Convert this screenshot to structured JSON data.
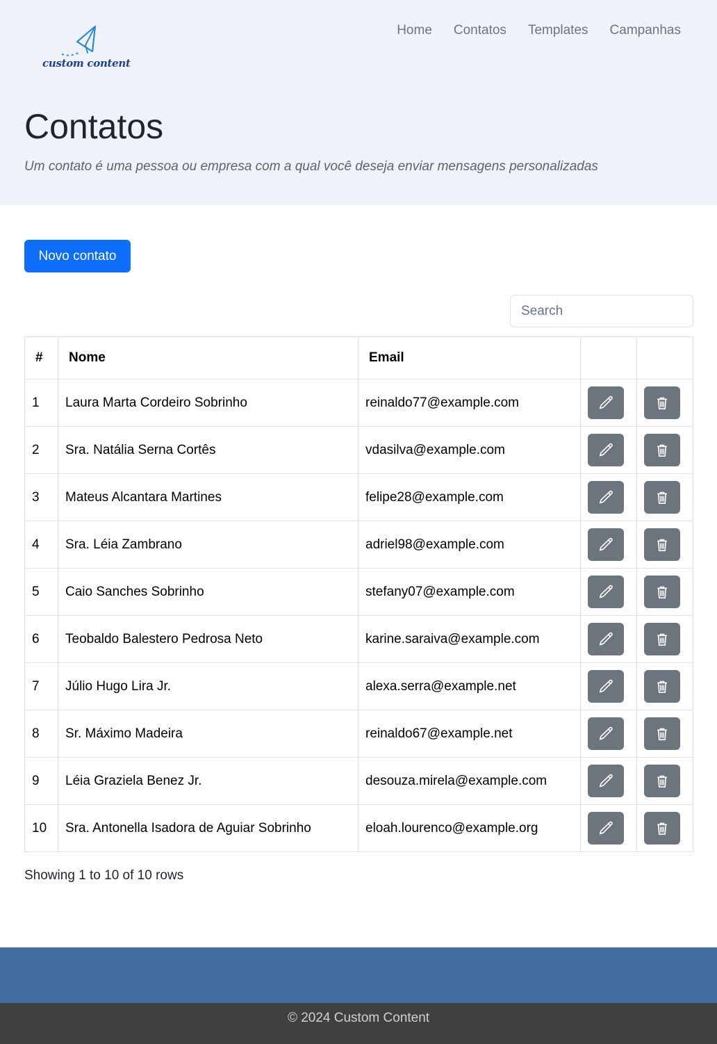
{
  "brand": {
    "logo_text": "custom content",
    "logo_icon": "paper-plane-icon",
    "logo_color": "#1f3f8f"
  },
  "nav": {
    "items": [
      {
        "label": "Home"
      },
      {
        "label": "Contatos"
      },
      {
        "label": "Templates"
      },
      {
        "label": "Campanhas"
      }
    ]
  },
  "header": {
    "title": "Contatos",
    "subtitle": "Um contato é uma pessoa ou empresa com a qual você deseja enviar mensagens personalizadas"
  },
  "toolbar": {
    "new_contact_label": "Novo contato",
    "search_placeholder": "Search"
  },
  "table": {
    "columns": [
      "#",
      "Nome",
      "Email",
      "",
      ""
    ],
    "rows": [
      {
        "id": "1",
        "name": "Laura Marta Cordeiro Sobrinho",
        "email": "reinaldo77@example.com"
      },
      {
        "id": "2",
        "name": "Sra. Natália Serna Cortês",
        "email": "vdasilva@example.com"
      },
      {
        "id": "3",
        "name": "Mateus Alcantara Martines",
        "email": "felipe28@example.com"
      },
      {
        "id": "4",
        "name": "Sra. Léia Zambrano",
        "email": "adriel98@example.com"
      },
      {
        "id": "5",
        "name": "Caio Sanches Sobrinho",
        "email": "stefany07@example.com"
      },
      {
        "id": "6",
        "name": "Teobaldo Balestero Pedrosa Neto",
        "email": "karine.saraiva@example.com"
      },
      {
        "id": "7",
        "name": "Júlio Hugo Lira Jr.",
        "email": "alexa.serra@example.net"
      },
      {
        "id": "8",
        "name": "Sr. Máximo Madeira",
        "email": "reinaldo67@example.net"
      },
      {
        "id": "9",
        "name": "Léia Graziela Benez Jr.",
        "email": "desouza.mirela@example.com"
      },
      {
        "id": "10",
        "name": "Sra. Antonella Isadora de Aguiar Sobrinho",
        "email": "eloah.lourenco@example.org"
      }
    ],
    "edit_icon": "pencil-icon",
    "delete_icon": "trash-icon"
  },
  "pagination": {
    "info": "Showing 1 to 10 of 10 rows"
  },
  "footer": {
    "copyright": "© 2024 Custom Content"
  },
  "colors": {
    "primary": "#0d6efd",
    "secondary": "#6c757d",
    "hero_bg": "#eef2f9",
    "footer_band": "#426f9f",
    "footer_bar": "#404040"
  }
}
